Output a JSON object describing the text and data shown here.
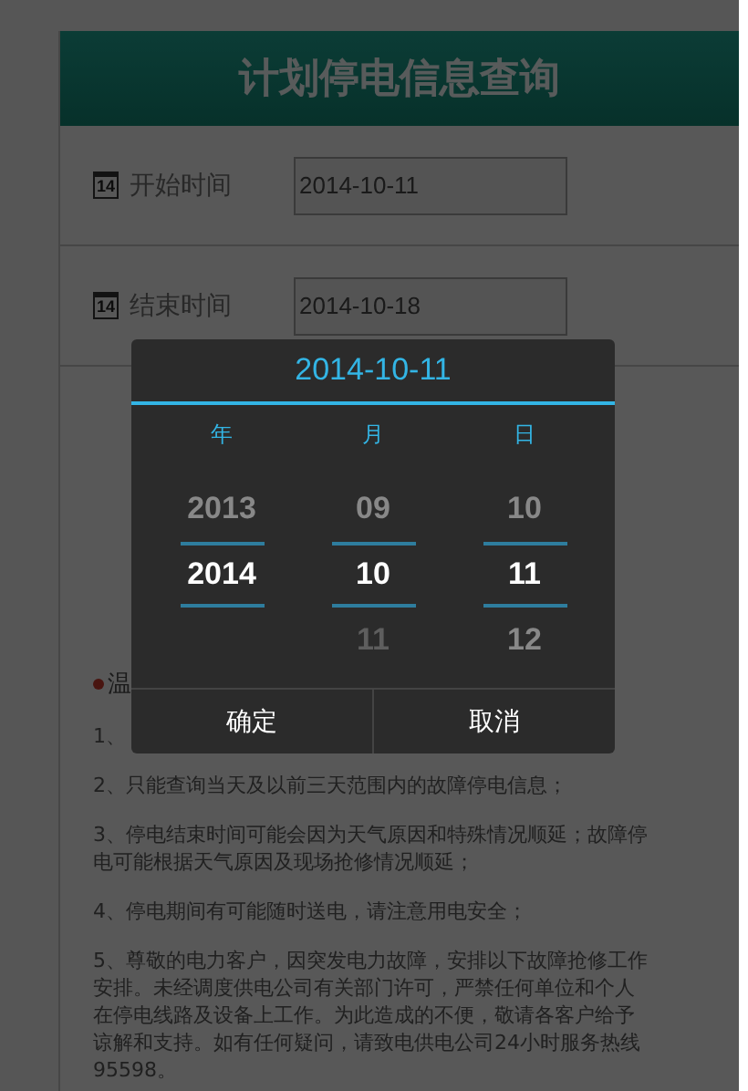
{
  "header": {
    "title": "计划停电信息查询"
  },
  "fields": [
    {
      "icon": "14",
      "label": "开始时间",
      "value": "2014-10-11"
    },
    {
      "icon": "14",
      "label": "结束时间",
      "value": "2014-10-18"
    }
  ],
  "notice": {
    "title": "温",
    "items": [
      "1、",
      "2、只能查询当天及以前三天范围内的故障停电信息；",
      "3、停电结束时间可能会因为天气原因和特殊情况顺延；故障停电可能根据天气原因及现场抢修情况顺延；",
      "4、停电期间有可能随时送电，请注意用电安全；",
      "5、尊敬的电力客户，因突发电力故障，安排以下故障抢修工作安排。未经调度供电公司有关部门许可，严禁任何单位和个人在停电线路及设备上工作。为此造成的不便，敬请各客户给予谅解和支持。如有任何疑问，请致电供电公司24小时服务热线95598。"
    ]
  },
  "picker": {
    "title": "2014-10-11",
    "columns": [
      {
        "label": "年",
        "items": [
          {
            "text": "2013",
            "selected": false,
            "disabled": false
          },
          {
            "text": "2014",
            "selected": true,
            "disabled": false
          }
        ]
      },
      {
        "label": "月",
        "items": [
          {
            "text": "09",
            "selected": false,
            "disabled": false
          },
          {
            "text": "10",
            "selected": true,
            "disabled": false
          },
          {
            "text": "11",
            "selected": false,
            "disabled": true
          }
        ]
      },
      {
        "label": "日",
        "items": [
          {
            "text": "10",
            "selected": false,
            "disabled": false
          },
          {
            "text": "11",
            "selected": true,
            "disabled": false
          },
          {
            "text": "12",
            "selected": false,
            "disabled": false
          }
        ]
      }
    ],
    "buttons": [
      "确定",
      "取消"
    ]
  }
}
